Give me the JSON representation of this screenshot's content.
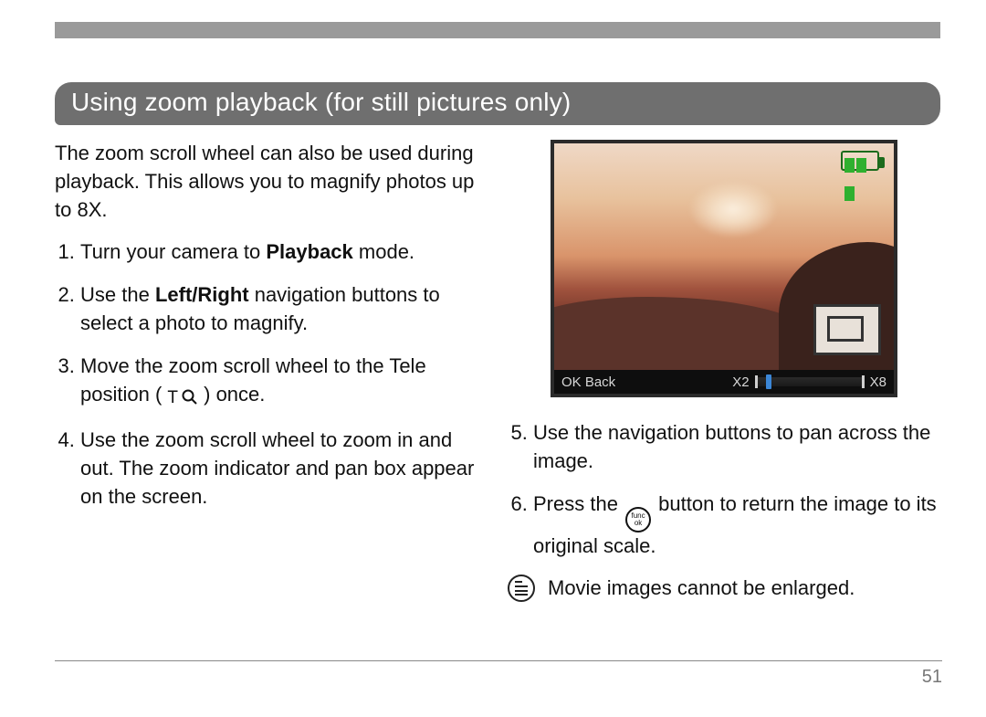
{
  "page": {
    "number": "51"
  },
  "section": {
    "title": "Using zoom playback (for still pictures only)",
    "intro": "The zoom scroll wheel can also be used during playback. This allows you to magnify photos up to 8X."
  },
  "steps_left": {
    "s1_a": "Turn your camera to ",
    "s1_b": "Playback",
    "s1_c": " mode.",
    "s2_a": "Use the ",
    "s2_b": "Left/Right",
    "s2_c": " navigation buttons to select a photo to magnify.",
    "s3_a": "Move the zoom scroll wheel to the Tele position ( ",
    "s3_tele": "T",
    "s3_b": " ) once.",
    "s4": "Use the zoom scroll wheel to zoom in and out. The zoom indicator and pan box appear on the screen."
  },
  "steps_right": {
    "s5": "Use the navigation buttons to pan across the image.",
    "s6_a": "Press the ",
    "s6_func_top": "func",
    "s6_func_bot": "ok",
    "s6_b": " button to return the image to its original scale."
  },
  "note": {
    "text": "Movie images cannot be enlarged."
  },
  "photo_overlay": {
    "ok_back": "OK Back",
    "x2": "X2",
    "x8": "X8"
  }
}
